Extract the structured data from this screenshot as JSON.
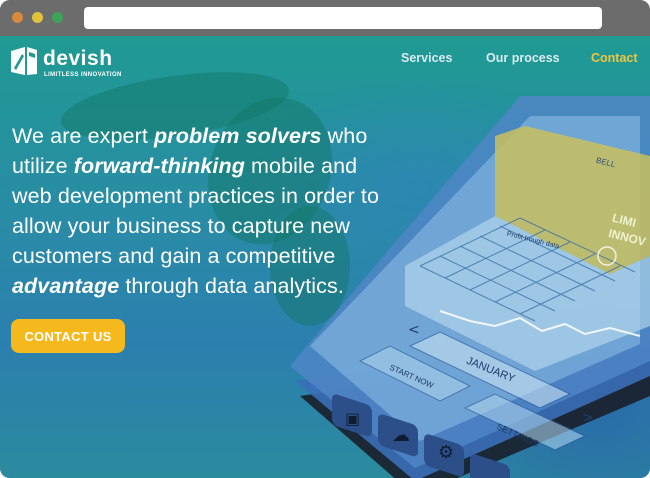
{
  "window": {
    "url": ""
  },
  "brand": {
    "name": "devish",
    "tagline": "LIMITLESS INNOVATION"
  },
  "nav": {
    "items": [
      {
        "label": "Services"
      },
      {
        "label": "Our process"
      },
      {
        "label": "Contact"
      }
    ]
  },
  "hero": {
    "line_parts": [
      "We are expert ",
      "problem solvers",
      " who",
      "utilize ",
      "forward-thinking",
      " mobile and",
      "web development practices in order to",
      "allow your business to capture new",
      "customers and gain a competitive",
      "advantage",
      " through data analytics."
    ]
  },
  "cta": {
    "label": "CONTACT US"
  },
  "phone": {
    "carrier": "BELL",
    "screen_brand": "LIMI INNOV",
    "chart_title": "Profit trough data",
    "month": "JANUARY",
    "start_now": "START NOW",
    "settings": "SETTINGS"
  },
  "colors": {
    "accent": "#f5b91d",
    "nav_active": "#f2c43a"
  }
}
